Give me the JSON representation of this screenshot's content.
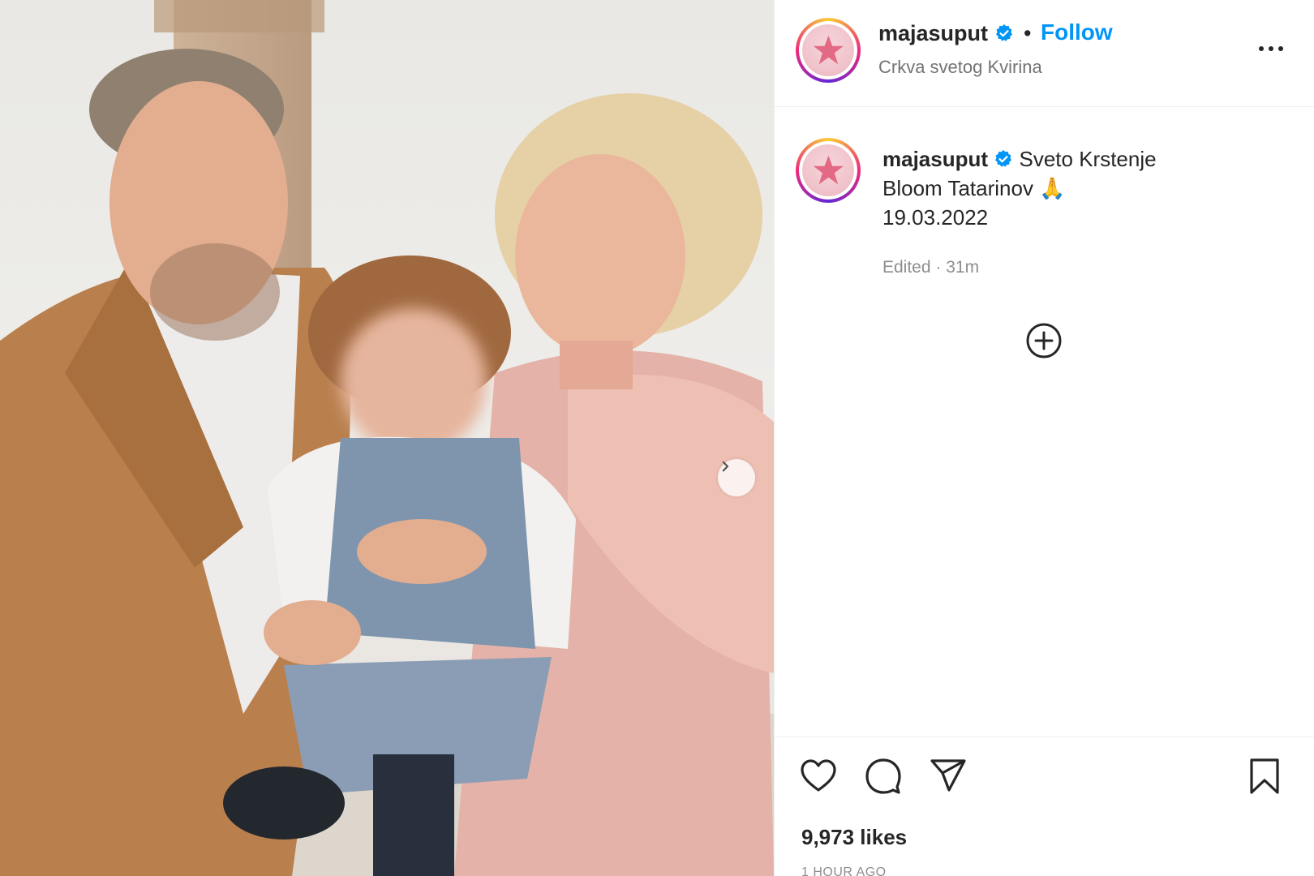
{
  "post": {
    "username": "majasuput",
    "separator": "•",
    "follow_label": "Follow",
    "location": "Crkva svetog Kvirina",
    "caption_line1": "Sveto Krstenje",
    "caption_line2": "Bloom Tatarinov 🙏",
    "caption_line3": "19.03.2022",
    "edited": "Edited · 31m",
    "likes": "9,973 likes",
    "time_ago": "1 HOUR AGO"
  },
  "icons": {
    "verified": "verified-badge-icon",
    "more": "more-options-icon",
    "plus": "add-comment-icon",
    "like": "heart-icon",
    "comment": "comment-icon",
    "share": "share-icon",
    "save": "bookmark-icon",
    "next": "chevron-right-icon"
  },
  "colors": {
    "link": "#0095f6",
    "secondary": "#737373",
    "border": "#efefef"
  }
}
